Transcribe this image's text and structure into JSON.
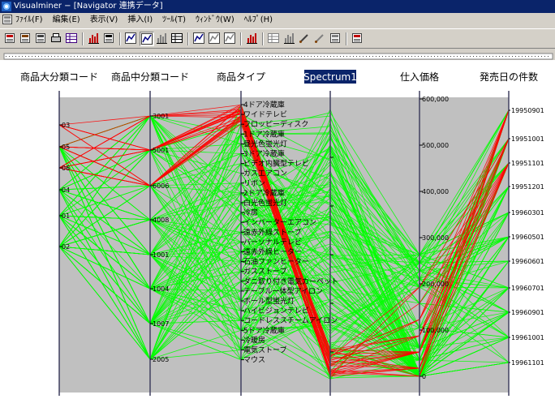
{
  "window": {
    "title": "Visualminer − [Navigator 連携データ]"
  },
  "menu": [
    {
      "id": "file",
      "label": "ﾌｧｲﾙ(F)"
    },
    {
      "id": "edit",
      "label": "編集(E)"
    },
    {
      "id": "view",
      "label": "表示(V)"
    },
    {
      "id": "insert",
      "label": "挿入(I)"
    },
    {
      "id": "tools",
      "label": "ﾂｰﾙ(T)"
    },
    {
      "id": "window",
      "label": "ｳｨﾝﾄﾞｳ(W)"
    },
    {
      "id": "help",
      "label": "ﾍﾙﾌﾟ(H)"
    }
  ],
  "toolbar": [
    {
      "name": "import-icon",
      "color": "#c00000"
    },
    {
      "name": "save-icon",
      "color": "#804000"
    },
    {
      "name": "copy-data-icon",
      "color": "#404040"
    },
    {
      "name": "print-icon",
      "color": "#000000"
    },
    {
      "name": "table-icon",
      "color": "#400080"
    },
    {
      "name": "bar-chart-icon",
      "color": "#c00000"
    },
    {
      "name": "report-icon",
      "color": "#000000"
    },
    {
      "name": "parallel-plot-icon",
      "color": "#000080"
    },
    {
      "name": "scatter-plot-icon",
      "color": "#000080",
      "pressed": true
    },
    {
      "name": "histogram-icon",
      "color": "#808080"
    },
    {
      "name": "grid-view-icon",
      "color": "#000000"
    },
    {
      "name": "zoom-plot-icon",
      "color": "#000080"
    },
    {
      "name": "select-plot-icon",
      "color": "#808080"
    },
    {
      "name": "filter-plot-icon",
      "color": "#808080"
    },
    {
      "name": "color-bars-icon",
      "color": "#c00000"
    },
    {
      "name": "layout-icon",
      "color": "#808080"
    },
    {
      "name": "columns-icon",
      "color": "#808080"
    },
    {
      "name": "brush-icon",
      "color": "#404040"
    },
    {
      "name": "pen-icon",
      "color": "#808080"
    },
    {
      "name": "export-icon",
      "color": "#808080"
    },
    {
      "name": "run-icon",
      "color": "#c00000"
    }
  ],
  "chart_data": {
    "type": "parallel-coordinates",
    "colors": {
      "background": "#c0c0c0",
      "axis": "#404060",
      "selected": "#ff0000",
      "other": "#00ff00",
      "highlight": "#0a246a"
    },
    "axes": [
      {
        "id": "a1",
        "label": "商品大分類コード",
        "ticks": [
          "03",
          "05",
          "06",
          "04",
          "01",
          "02"
        ]
      },
      {
        "id": "a2",
        "label": "商品中分類コード",
        "ticks": [
          "3001",
          "5001",
          "6006",
          "4008",
          "1001",
          "1004",
          "1007",
          "2005"
        ]
      },
      {
        "id": "a3",
        "label": "商品タイプ",
        "ticks": [
          "4ドア冷蔵庫",
          "ワイドテレビ",
          "フロッピーディスク",
          "1ドア冷蔵庫",
          "昼光色蛍光灯",
          "3ドア冷蔵庫",
          "ビデオ内臓型テレビ",
          "ガス工アコン",
          "リボン",
          "2ドア冷蔵庫",
          "白光色蛍光灯",
          "冷房",
          "インバーターエアコン",
          "遠赤外線ストーブ",
          "パーソナルテレビ",
          "遠赤外線ヒーター",
          "石油ファンヒーター",
          "ガスストーブ",
          "ダニ取り付き電気カーペット",
          "テーブル一体型アイロン",
          "ボール型蛍光灯",
          "ハイビジョンテレビ",
          "コードレススチームアイロン",
          "5ドア冷蔵庫",
          "冷暖房",
          "電気ストーブ",
          "マウス"
        ]
      },
      {
        "id": "a4",
        "label": "Spectrum1",
        "highlighted": true,
        "ticks": []
      },
      {
        "id": "a5",
        "label": "仕入価格",
        "ticks": [
          "600,000",
          "500,000",
          "400,000",
          "300,000",
          "200,000",
          "100,000",
          "0"
        ]
      },
      {
        "id": "a6",
        "label": "発売日の件数",
        "ticks": [
          "19950901",
          "19951001",
          "19951101",
          "19951201",
          "19960301",
          "19960501",
          "19960601",
          "19960701",
          "19960901",
          "19961001",
          "19961101"
        ]
      }
    ]
  }
}
